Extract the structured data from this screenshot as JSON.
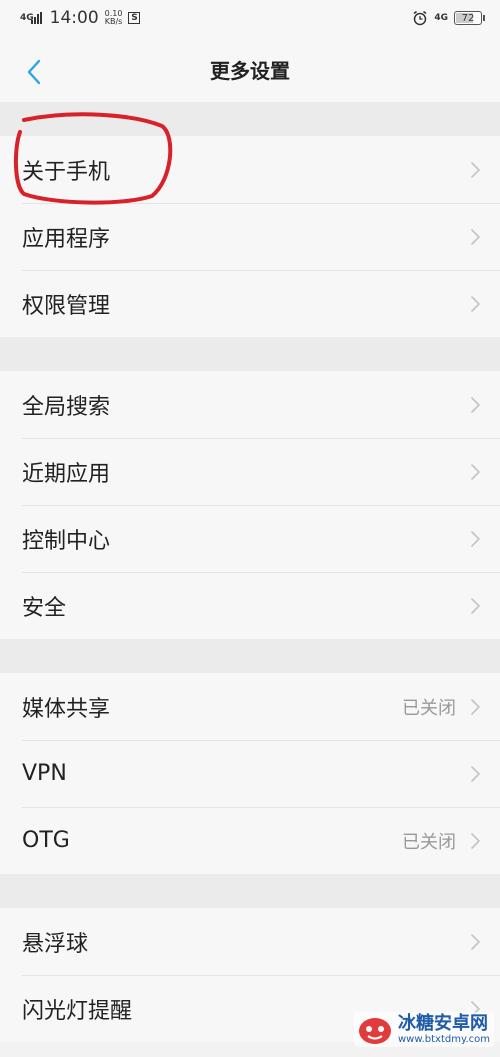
{
  "status_bar": {
    "network": "4G",
    "time": "14:00",
    "speed_value": "0.10",
    "speed_unit": "KB/s",
    "s_icon": "S",
    "network_right": "4G",
    "battery": "72",
    "battery_level": 0.72
  },
  "header": {
    "title": "更多设置",
    "back_icon": "chevron-left-icon",
    "accent": "#2aa6e6"
  },
  "groups": [
    {
      "items": [
        {
          "label": "关于手机"
        },
        {
          "label": "应用程序"
        },
        {
          "label": "权限管理"
        }
      ]
    },
    {
      "items": [
        {
          "label": "全局搜索"
        },
        {
          "label": "近期应用"
        },
        {
          "label": "控制中心"
        },
        {
          "label": "安全"
        }
      ]
    },
    {
      "items": [
        {
          "label": "媒体共享",
          "value": "已关闭"
        },
        {
          "label": "VPN"
        },
        {
          "label": "OTG",
          "value": "已关闭"
        }
      ]
    },
    {
      "items": [
        {
          "label": "悬浮球"
        },
        {
          "label": "闪光灯提醒"
        }
      ]
    }
  ],
  "watermark": {
    "name": "冰糖安卓网",
    "url": "www.btxtdmy.com"
  },
  "colors": {
    "annotation": "#d8222a",
    "watermark": "#1e5ba8"
  }
}
